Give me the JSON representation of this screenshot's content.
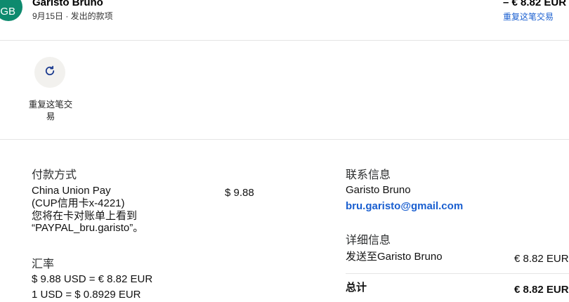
{
  "header": {
    "avatar_initials": "GB",
    "name": "Garisto Bruno",
    "subtitle": "9月15日 · 发出的款项",
    "amount": "– € 8.82 EUR",
    "repeat_link": "重复这笔交易"
  },
  "actions": {
    "repeat_label": "重复这笔交易"
  },
  "payment": {
    "title": "付款方式",
    "method_line1": "China Union Pay",
    "method_line2": "(CUP信用卡x-4221)",
    "method_line3": "您将在卡对账单上看到",
    "method_line4": "“PAYPAL_bru.garisto”。",
    "amount": "$ 9.88"
  },
  "exchange": {
    "title": "汇率",
    "line1": "$ 9.88 USD = € 8.82 EUR",
    "line2": "1 USD = $ 0.8929 EUR"
  },
  "contact": {
    "title": "联系信息",
    "name": "Garisto Bruno",
    "email": "bru.garisto@gmail.com"
  },
  "details": {
    "title": "详细信息",
    "sent_to_label": "发送至Garisto Bruno",
    "sent_to_amount": "€ 8.82 EUR",
    "total_label": "总计",
    "total_amount": "€ 8.82 EUR"
  },
  "colors": {
    "avatar": "#0e8a6e",
    "link": "#1a5fd0"
  }
}
